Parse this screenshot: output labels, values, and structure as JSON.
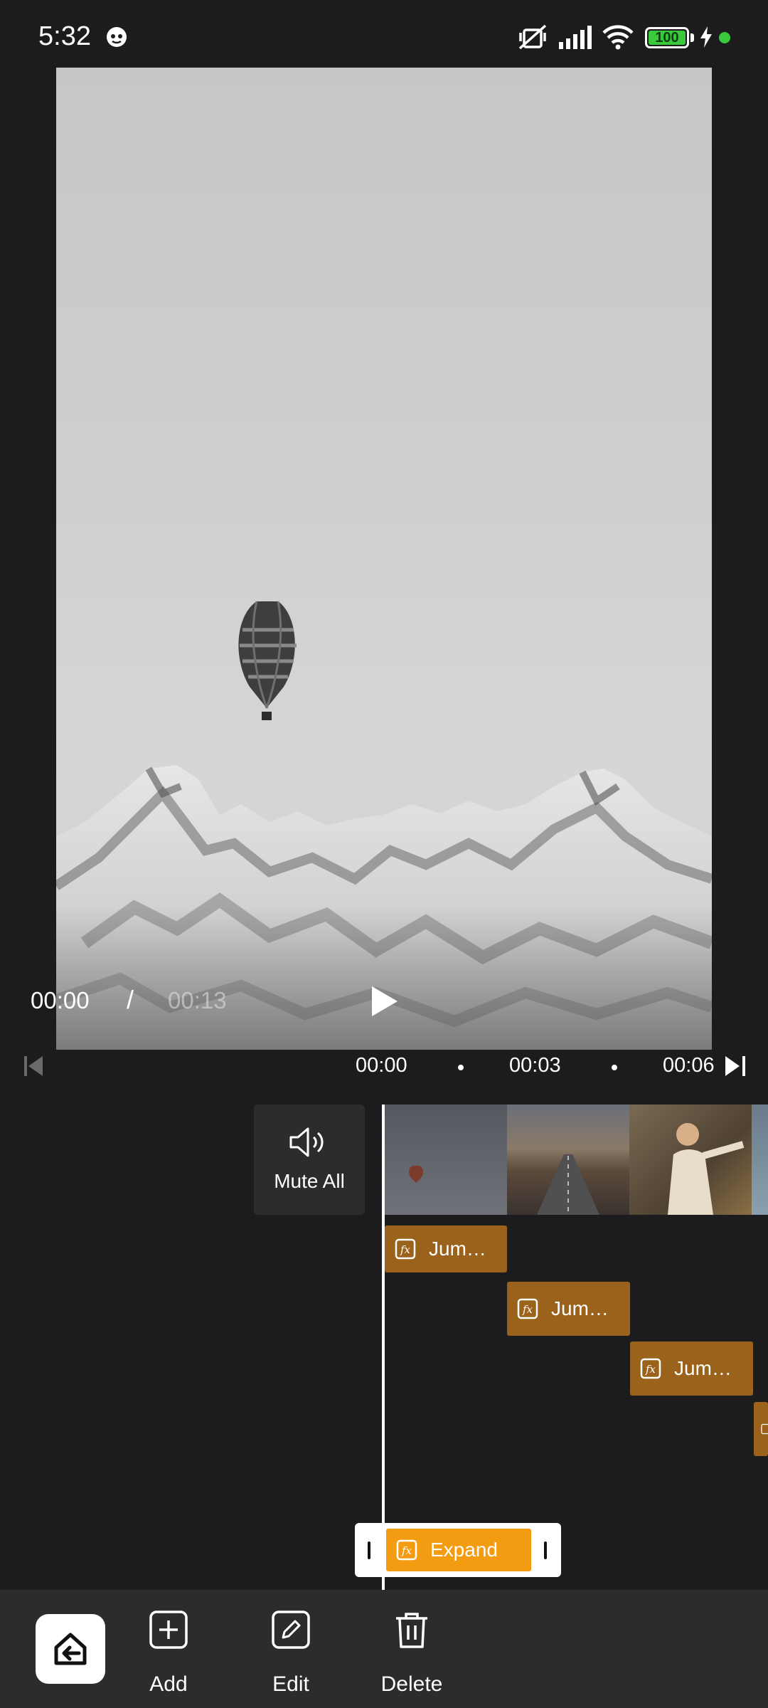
{
  "status_bar": {
    "time": "5:32",
    "battery": "100"
  },
  "player": {
    "current_time": "00:00",
    "separator": "/",
    "total_time": "00:13"
  },
  "ruler": {
    "labels": [
      "00:00",
      "00:03",
      "00:06"
    ]
  },
  "timeline": {
    "mute_all_label": "Mute All",
    "effects": [
      {
        "label": "Jum…"
      },
      {
        "label": "Jum…"
      },
      {
        "label": "Jum…"
      }
    ],
    "selected_effect": {
      "label": "Expand"
    }
  },
  "toolbar": {
    "add_label": "Add",
    "edit_label": "Edit",
    "delete_label": "Delete"
  },
  "colors": {
    "background": "#1c1c1e",
    "effect_clip": "#9b621b",
    "selected_clip": "#f39c12",
    "battery": "#39c93b"
  }
}
